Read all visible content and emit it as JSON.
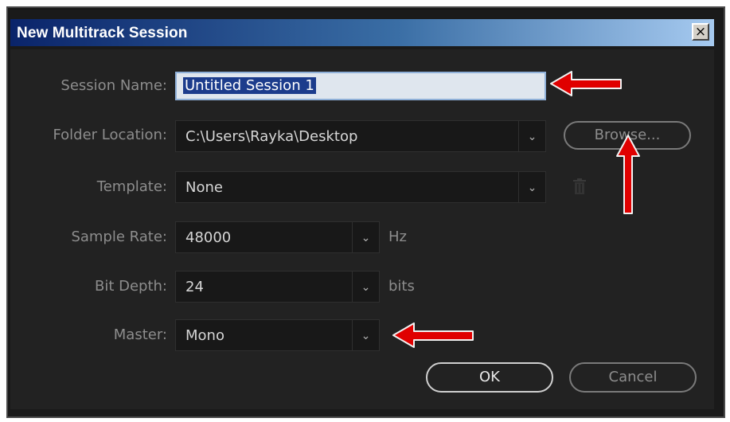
{
  "window": {
    "title": "New Multitrack Session",
    "close_glyph": "×"
  },
  "session_name": {
    "label": "Session Name:",
    "value": "Untitled Session 1"
  },
  "folder_location": {
    "label": "Folder Location:",
    "value": "C:\\Users\\Rayka\\Desktop",
    "browse_label": "Browse..."
  },
  "template": {
    "label": "Template:",
    "value": "None"
  },
  "sample_rate": {
    "label": "Sample Rate:",
    "value": "48000",
    "unit": "Hz"
  },
  "bit_depth": {
    "label": "Bit Depth:",
    "value": "24",
    "unit": "bits"
  },
  "master": {
    "label": "Master:",
    "value": "Mono"
  },
  "buttons": {
    "ok": "OK",
    "cancel": "Cancel"
  },
  "colors": {
    "titlebar_start": "#0a246a",
    "titlebar_end": "#a6caf0",
    "annotation_arrow": "#e00000",
    "dialog_bg": "#222222"
  },
  "icons": {
    "dropdown": "chevron-down-icon",
    "delete_template": "trash-icon",
    "close": "close-icon"
  }
}
